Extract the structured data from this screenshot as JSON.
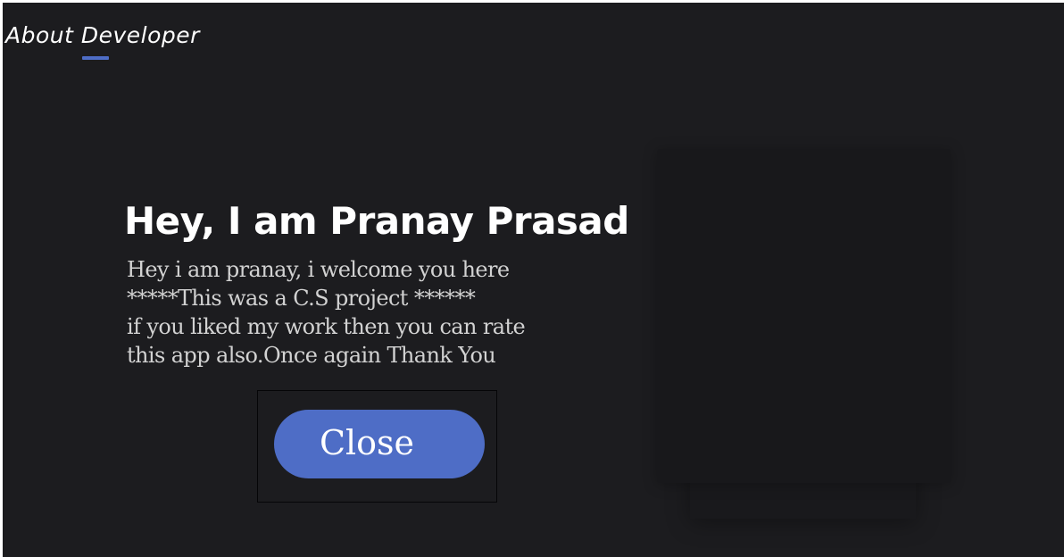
{
  "window": {
    "title": "About  Developer"
  },
  "main": {
    "heading": "Hey, I am Pranay Prasad",
    "message_lines": [
      "Hey i am pranay, i welcome you here",
      "*****This was a C.S project ******",
      "if you liked my work then you can rate",
      "this app also.Once again Thank You"
    ],
    "close_label": "Close"
  },
  "colors": {
    "background": "#1c1c1f",
    "accent": "#4e6dc6",
    "panel": "#18181b",
    "text": "#ffffff",
    "body_text": "#d2d2d2"
  }
}
